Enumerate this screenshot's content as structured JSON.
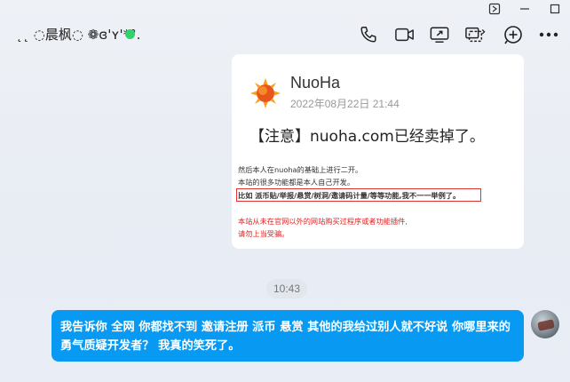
{
  "chat": {
    "title": "˛˛ ◌晨枫◌ ❁ɞ'ʏ'*°.",
    "online_color": "#2ed36a"
  },
  "header_icons": [
    "phone-icon",
    "video-icon",
    "screen-share-icon",
    "remote-control-icon",
    "add-member-icon",
    "more-icon"
  ],
  "window_controls": [
    "pin-icon",
    "minimize-icon",
    "maximize-icon"
  ],
  "shared_card": {
    "site_name": "NuoHa",
    "date": "2022年08月22日 21:44",
    "notice": "【注意】nuoha.com已经卖掉了。",
    "lines": [
      "然后本人在nuoha的基础上进行二开。",
      "本站的很多功能都是本人自己开发。",
      "比如 派币贴/举报/悬赏/树洞/邀请码计量/等等功能,我不一一举例了。",
      "本站从未在官网以外的网站购买过程序或者功能插件,",
      "请勿上当受骗。"
    ]
  },
  "time": "10:43",
  "message": {
    "text": "我告诉你 全网 你都找不到 邀请注册 派币 悬赏 其他的我给过别人就不好说 你哪里来的勇气质疑开发者？ 我真的笑死了。",
    "bubble_color": "#0899f2"
  }
}
